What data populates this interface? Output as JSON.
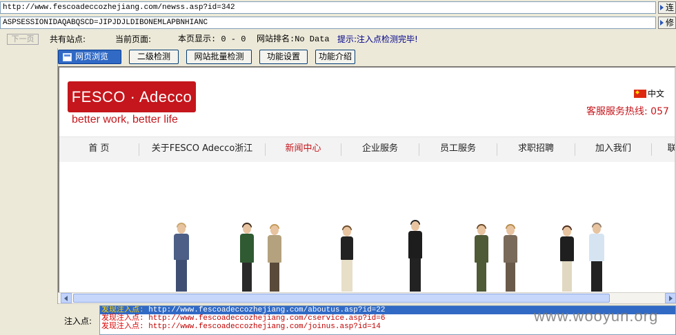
{
  "url_bar": {
    "value": "http://www.fescoadeccozhejiang.com/newss.asp?id=342",
    "go_label": "连"
  },
  "cookie_bar": {
    "value": "ASPSESSIONIDAQABQSCD=JIPJDJLDIBONEMLAPBNHIANC",
    "button_label": "修"
  },
  "status": {
    "prev_page": "下一页",
    "sites": "共有站点:",
    "current_page": "当前页面:",
    "page_show": "本页显示: 0 - 0",
    "rank": "网站排名:No Data",
    "tip": "提示:注入点检测完毕!"
  },
  "tabs": [
    {
      "label": "网页浏览"
    },
    {
      "label": "二级检测"
    },
    {
      "label": "网站批量检测"
    },
    {
      "label": "功能设置"
    },
    {
      "label": "功能介绍"
    }
  ],
  "site": {
    "logo_text": "FESCO · Adecco",
    "slogan": "better work, better life",
    "lang": "中文",
    "hotline": "客服服务热线: 057",
    "nav": [
      "首  页",
      "关于FESCO Adecco浙江",
      "新闻中心",
      "企业服务",
      "员工服务",
      "求职招聘",
      "加入我们",
      "联"
    ],
    "active_nav": "新闻中心"
  },
  "injection": {
    "label": "注入点:",
    "prefix": "发现注入点:",
    "rows": [
      "http://www.fescoadeccozhejiang.com/aboutus.asp?id=22",
      "http://www.fescoadeccozhejiang.com/cservice.asp?id=6",
      "http://www.fescoadeccozhejiang.com/joinus.asp?id=14"
    ]
  },
  "watermark": "www.wooyun.org",
  "colors": {
    "brand_red": "#c4161c",
    "selection_blue": "#316ac5",
    "tip_blue": "#00008b"
  }
}
